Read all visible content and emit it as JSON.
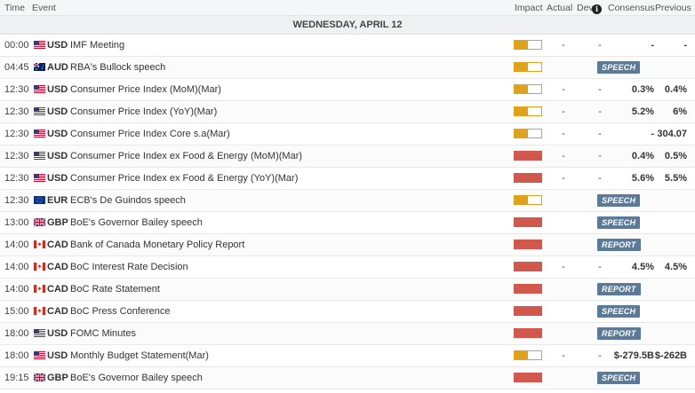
{
  "header": {
    "time": "Time",
    "event": "Event",
    "impact": "Impact",
    "actual": "Actual",
    "dev": "Dev",
    "info_icon": "info-icon",
    "consensus": "Consensus",
    "previous": "Previous"
  },
  "date_header": "WEDNESDAY, APRIL 12",
  "colors": {
    "impact_medium": "#e0a21b",
    "impact_high": "#d2574c",
    "tag_bg": "#5b7a99"
  },
  "rows": [
    {
      "time": "00:00",
      "flag": "us-flag-icon",
      "currency": "USD",
      "event": "IMF Meeting",
      "impact": "medium",
      "actual": "-",
      "dev": "-",
      "consensus": "-",
      "previous": "-",
      "tag": ""
    },
    {
      "time": "04:45",
      "flag": "au-flag-icon",
      "currency": "AUD",
      "event": "RBA's Bullock speech",
      "impact": "medium",
      "actual": "",
      "dev": "",
      "consensus": "",
      "previous": "",
      "tag": "SPEECH"
    },
    {
      "time": "12:30",
      "flag": "us-flag-icon",
      "currency": "USD",
      "event": "Consumer Price Index (MoM)(Mar)",
      "impact": "medium",
      "actual": "-",
      "dev": "-",
      "consensus": "0.3%",
      "previous": "0.4%",
      "tag": ""
    },
    {
      "time": "12:30",
      "flag": "us-flag-icon",
      "currency": "USD",
      "event": "Consumer Price Index (YoY)(Mar)",
      "impact": "medium",
      "actual": "-",
      "dev": "-",
      "consensus": "5.2%",
      "previous": "6%",
      "tag": ""
    },
    {
      "time": "12:30",
      "flag": "us-flag-icon",
      "currency": "USD",
      "event": "Consumer Price Index Core s.a(Mar)",
      "impact": "medium",
      "actual": "-",
      "dev": "-",
      "consensus": "-",
      "previous": "304.07",
      "tag": ""
    },
    {
      "time": "12:30",
      "flag": "us-flag-icon",
      "currency": "USD",
      "event": "Consumer Price Index ex Food & Energy (MoM)(Mar)",
      "impact": "high",
      "actual": "-",
      "dev": "-",
      "consensus": "0.4%",
      "previous": "0.5%",
      "tag": ""
    },
    {
      "time": "12:30",
      "flag": "us-flag-icon",
      "currency": "USD",
      "event": "Consumer Price Index ex Food & Energy (YoY)(Mar)",
      "impact": "high",
      "actual": "-",
      "dev": "-",
      "consensus": "5.6%",
      "previous": "5.5%",
      "tag": ""
    },
    {
      "time": "12:30",
      "flag": "eu-flag-icon",
      "currency": "EUR",
      "event": "ECB's De Guindos speech",
      "impact": "medium",
      "actual": "",
      "dev": "",
      "consensus": "",
      "previous": "",
      "tag": "SPEECH"
    },
    {
      "time": "13:00",
      "flag": "gb-flag-icon",
      "currency": "GBP",
      "event": "BoE's Governor Bailey speech",
      "impact": "high",
      "actual": "",
      "dev": "",
      "consensus": "",
      "previous": "",
      "tag": "SPEECH"
    },
    {
      "time": "14:00",
      "flag": "ca-flag-icon",
      "currency": "CAD",
      "event": "Bank of Canada Monetary Policy Report",
      "impact": "high",
      "actual": "",
      "dev": "",
      "consensus": "",
      "previous": "",
      "tag": "REPORT"
    },
    {
      "time": "14:00",
      "flag": "ca-flag-icon",
      "currency": "CAD",
      "event": "BoC Interest Rate Decision",
      "impact": "high",
      "actual": "-",
      "dev": "-",
      "consensus": "4.5%",
      "previous": "4.5%",
      "tag": ""
    },
    {
      "time": "14:00",
      "flag": "ca-flag-icon",
      "currency": "CAD",
      "event": "BoC Rate Statement",
      "impact": "high",
      "actual": "",
      "dev": "",
      "consensus": "",
      "previous": "",
      "tag": "REPORT"
    },
    {
      "time": "15:00",
      "flag": "ca-flag-icon",
      "currency": "CAD",
      "event": "BoC Press Conference",
      "impact": "high",
      "actual": "",
      "dev": "",
      "consensus": "",
      "previous": "",
      "tag": "SPEECH"
    },
    {
      "time": "18:00",
      "flag": "us-flag-icon",
      "currency": "USD",
      "event": "FOMC Minutes",
      "impact": "high",
      "actual": "",
      "dev": "",
      "consensus": "",
      "previous": "",
      "tag": "REPORT"
    },
    {
      "time": "18:00",
      "flag": "us-flag-icon",
      "currency": "USD",
      "event": "Monthly Budget Statement(Mar)",
      "impact": "medium",
      "actual": "-",
      "dev": "-",
      "consensus": "$-279.5B",
      "previous": "$-262B",
      "tag": ""
    },
    {
      "time": "19:15",
      "flag": "gb-flag-icon",
      "currency": "GBP",
      "event": "BoE's Governor Bailey speech",
      "impact": "high",
      "actual": "",
      "dev": "",
      "consensus": "",
      "previous": "",
      "tag": "SPEECH"
    }
  ]
}
